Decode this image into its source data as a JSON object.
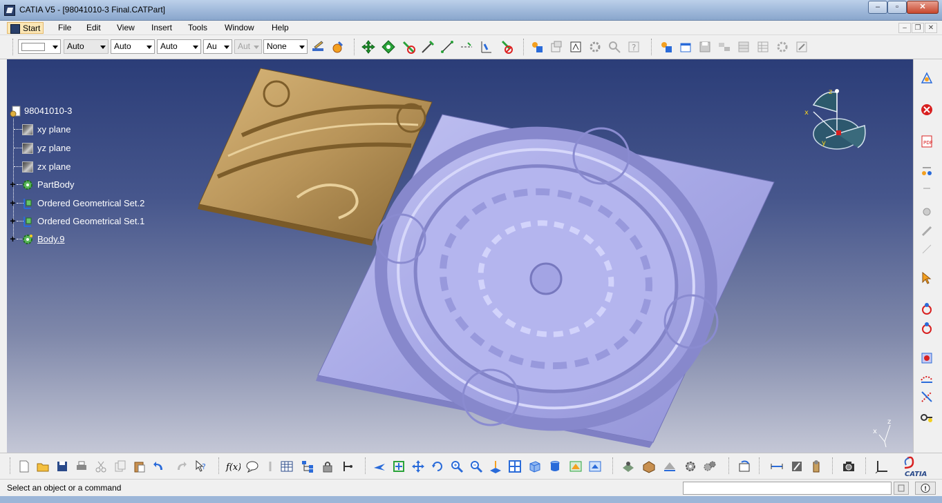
{
  "window": {
    "title": "CATIA V5 - [98041010-3 Final.CATPart]",
    "min": "–",
    "max": "▫",
    "close": "✕"
  },
  "menu": {
    "start": "Start",
    "file": "File",
    "edit": "Edit",
    "view": "View",
    "insert": "Insert",
    "tools": "Tools",
    "window": "Window",
    "help": "Help"
  },
  "graphic_properties": {
    "linetype": "Auto",
    "thickness": "Auto",
    "point_symbol": "Auto",
    "layer": "Au",
    "render": "Aut",
    "none": "None"
  },
  "spec_tree": {
    "root": "98041010-3",
    "items": [
      {
        "label": "xy plane"
      },
      {
        "label": "yz plane"
      },
      {
        "label": "zx plane"
      },
      {
        "label": "PartBody"
      },
      {
        "label": "Ordered Geometrical Set.2"
      },
      {
        "label": "Ordered Geometrical Set.1"
      },
      {
        "label": "Body.9"
      }
    ]
  },
  "compass": {
    "x": "x",
    "y": "y",
    "z": "z"
  },
  "axis_mini": {
    "x": "x",
    "z": "z"
  },
  "status": {
    "message": "Select an object or a command"
  },
  "logo": {
    "text": "CATIA"
  },
  "colors": {
    "part_tile_gold": "#b9955a",
    "part_tile_lilac": "#a7a8e6",
    "viewport_top": "#2b3d78",
    "viewport_bottom": "#c4c7d6"
  }
}
